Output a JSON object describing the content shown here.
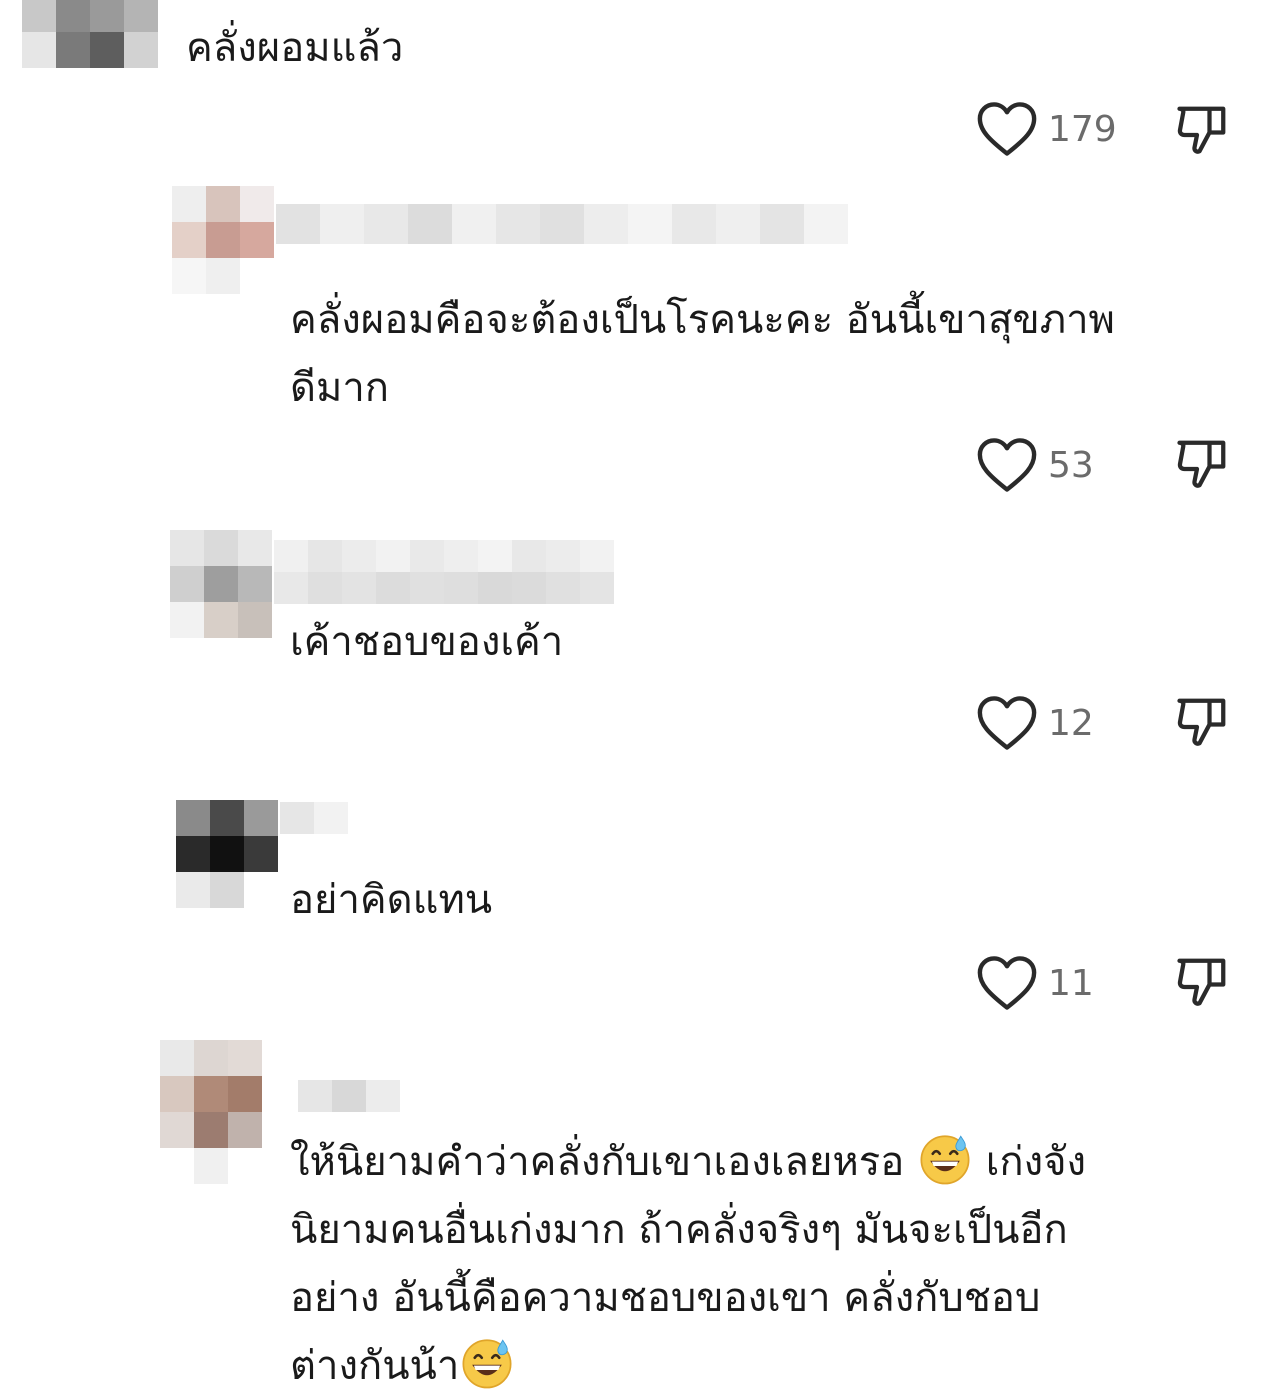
{
  "comments": [
    {
      "text": "คลั่งผอมแล้ว",
      "likes": "179"
    },
    {
      "text": "คลั่งผอมคือจะต้องเป็นโรคนะคะ อันนี้เขาสุขภาพ\nดีมาก",
      "likes": "53"
    },
    {
      "text": "เค้าชอบของเค้า",
      "likes": "12"
    },
    {
      "text": "อย่าคิดแทน",
      "likes": "11"
    },
    {
      "text_1": "ให้นิยามคำว่าคลั่งกับเขาเองเลยหรอ ",
      "text_2": " เก่งจัง\nนิยามคนอื่นเก่งมาก ถ้าคลั่งจริงๆ มันจะเป็นอีก\nอย่าง อันนี้คือความชอบของเขา คลั่งกับชอบ\nต่างกันน้า",
      "emoji": "grinning-face-with-sweat"
    }
  ],
  "icons": {
    "like": "heart-outline-icon",
    "dislike": "thumbs-down-icon"
  },
  "colors": {
    "text": "#1a1a1a",
    "count": "#6b6b6b",
    "icon": "#2a2a2a"
  }
}
